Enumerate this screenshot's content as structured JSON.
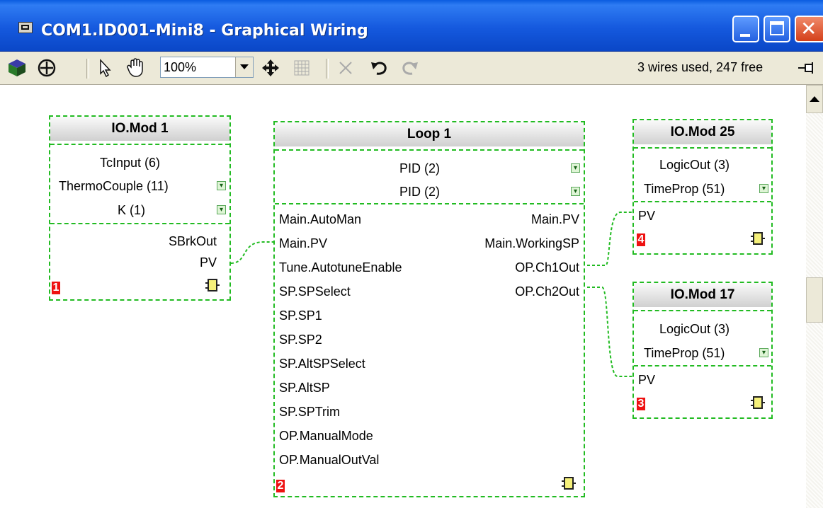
{
  "window": {
    "title": "COM1.ID001-Mini8 - Graphical Wiring",
    "buttons": {
      "minimize": "minimize",
      "maximize": "maximize",
      "close": "✕"
    }
  },
  "toolbar": {
    "zoom_value": "100%",
    "status": "3 wires used, 247 free",
    "icons": [
      "block-icon",
      "add-icon",
      "pointer-icon",
      "hand-icon",
      "move-icon",
      "grid-icon",
      "delete-icon",
      "undo-icon",
      "redo-icon",
      "pin-icon"
    ]
  },
  "blocks": {
    "iomod1": {
      "title": "IO.Mod 1",
      "params": [
        {
          "label": "TcInput (6)",
          "has_dropdown": false
        },
        {
          "label": "ThermoCouple (11)",
          "has_dropdown": true
        },
        {
          "label": "K (1)",
          "has_dropdown": true
        }
      ],
      "outputs": [
        "SBrkOut",
        "PV"
      ],
      "index": "1"
    },
    "loop1": {
      "title": "Loop 1",
      "params": [
        {
          "label": "PID (2)",
          "has_dropdown": true
        },
        {
          "label": "PID (2)",
          "has_dropdown": true
        }
      ],
      "inputs": [
        "Main.AutoMan",
        "Main.PV",
        "Tune.AutotuneEnable",
        "SP.SPSelect",
        "SP.SP1",
        "SP.SP2",
        "SP.AltSPSelect",
        "SP.AltSP",
        "SP.SPTrim",
        "OP.ManualMode",
        "OP.ManualOutVal"
      ],
      "outputs": [
        "Main.PV",
        "Main.WorkingSP",
        "OP.Ch1Out",
        "OP.Ch2Out"
      ],
      "index": "2"
    },
    "iomod25": {
      "title": "IO.Mod 25",
      "params": [
        {
          "label": "LogicOut (3)",
          "has_dropdown": false
        },
        {
          "label": "TimeProp (51)",
          "has_dropdown": true
        }
      ],
      "inputs": [
        "PV"
      ],
      "index": "4"
    },
    "iomod17": {
      "title": "IO.Mod 17",
      "params": [
        {
          "label": "LogicOut (3)",
          "has_dropdown": false
        },
        {
          "label": "TimeProp (51)",
          "has_dropdown": true
        }
      ],
      "inputs": [
        "PV"
      ],
      "index": "3"
    }
  },
  "wires": [
    {
      "from": "IO.Mod 1.PV",
      "to": "Loop 1.Main.PV"
    },
    {
      "from": "Loop 1.OP.Ch1Out",
      "to": "IO.Mod 25.PV"
    },
    {
      "from": "Loop 1.OP.Ch2Out",
      "to": "IO.Mod 17.PV"
    }
  ],
  "colors": {
    "wire": "#22bb22",
    "index_badge": "#ee1111",
    "titlebar": "#1559de"
  }
}
